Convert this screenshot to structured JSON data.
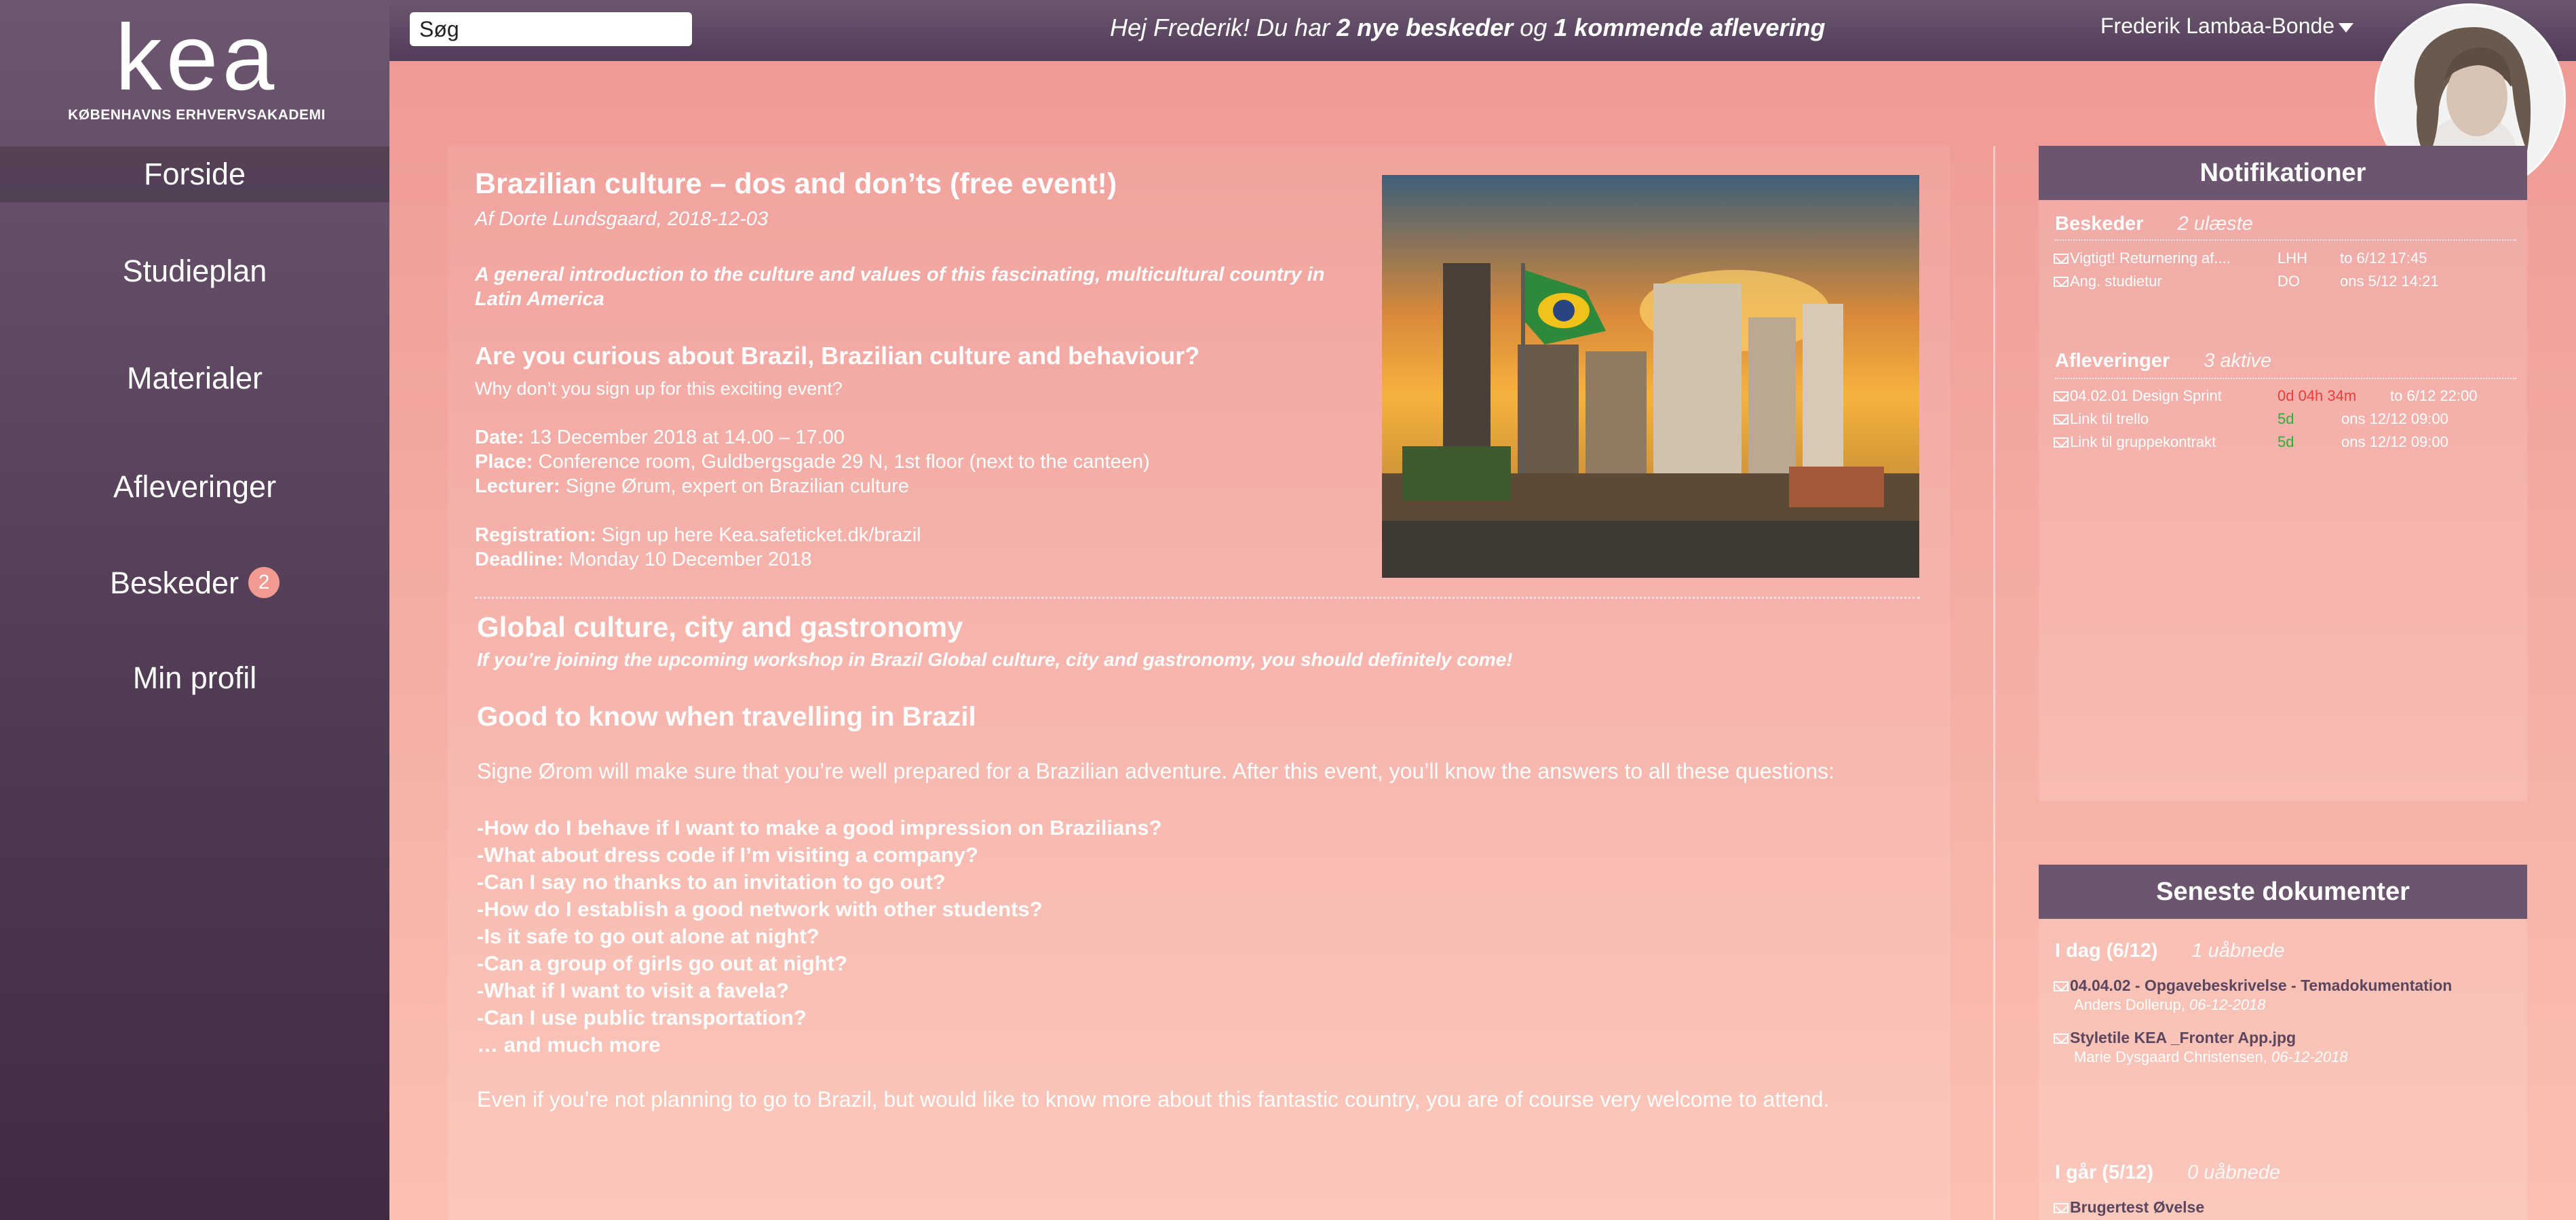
{
  "logo": {
    "word": "kea",
    "subtitle": "KØBENHAVNS ERHVERVSAKADEMI"
  },
  "nav": [
    {
      "label": "Forside"
    },
    {
      "label": "Studieplan"
    },
    {
      "label": "Materialer"
    },
    {
      "label": "Afleveringer"
    },
    {
      "label": "Beskeder",
      "badge": "2"
    },
    {
      "label": "Min profil"
    }
  ],
  "topbar": {
    "search_value": "Søg",
    "greeting_pre": "Hej Frederik! Du har ",
    "greeting_b1": "2 nye beskeder",
    "greeting_mid": " og ",
    "greeting_b2": "1 kommende aflevering",
    "user_name": "Frederik Lambaa-Bonde"
  },
  "article": {
    "title": "Brazilian culture – dos and don’ts (free event!)",
    "byline": "Af Dorte Lundsgaard, 2018-12-03",
    "intro_line1": "A general introduction to the culture and values of this fascinating, multicultural country in",
    "intro_line2": "Latin America",
    "question_title": "Are you curious about Brazil, Brazilian culture and behaviour?",
    "question_sub": "Why don’t you sign up for this exciting event?",
    "date_label": "Date:",
    "date_value": " 13 December 2018 at 14.00 – 17.00",
    "place_label": "Place:",
    "place_value": " Conference room, Guldbergsgade 29 N, 1st floor (next to the canteen)",
    "lecturer_label": "Lecturer:",
    "lecturer_value": " Signe Ørum, expert on Brazilian culture",
    "registration_label": "Registration:",
    "registration_value": " Sign up here Kea.safeticket.dk/brazil",
    "deadline_label": "Deadline:",
    "deadline_value": " Monday 10 December 2018",
    "section2_title": "Global culture, city and gastronomy",
    "section2_sub": "If you’re joining the upcoming workshop in Brazil Global culture, city and gastronomy, you should definitely come!",
    "section3_title": "Good to know when travelling in Brazil",
    "section3_text": "Signe Ørom will make sure that you’re well prepared for a Brazilian adventure. After this event, you’ll know the answers to all these questions:",
    "questions": [
      "-How do I behave if I want to make a good impression on Brazilians?",
      "-What about dress code if I’m visiting a company?",
      "-Can I say no thanks to an invitation to go out?",
      "-How do I establish a good network with other students?",
      "-Is it safe to go out alone at night?",
      "-Can a group of girls go out at night?",
      "-What if I want to visit a favela?",
      "-Can I use public transportation?",
      "… and much more"
    ],
    "closing": "Even if you’re not planning to go to Brazil, but would like to know more about this fantastic country, you are of course very welcome to attend."
  },
  "notifications": {
    "header": "Notifikationer",
    "messages_label": "Beskeder",
    "messages_count": "2 ulæste",
    "messages": [
      {
        "title": "Vigtigt! Returnering af....",
        "from": "LHH",
        "time": "to 6/12 17:45"
      },
      {
        "title": "Ang. studietur",
        "from": "DO",
        "time": "ons 5/12 14:21"
      }
    ],
    "assignments_label": "Afleveringer",
    "assignments_count": "3 aktive",
    "assignments": [
      {
        "title": "04.02.01 Design Sprint",
        "remaining": "0d 04h 34m",
        "status": "red",
        "due": "to 6/12 22:00"
      },
      {
        "title": "Link til trello",
        "remaining": "5d",
        "status": "green",
        "due": "ons 12/12  09:00"
      },
      {
        "title": "Link til gruppekontrakt",
        "remaining": "5d",
        "status": "green",
        "due": "ons 12/12  09:00"
      }
    ]
  },
  "documents": {
    "header": "Seneste dokumenter",
    "today_label": "I dag (6/12)",
    "today_count": "1 uåbnede",
    "today_docs": [
      {
        "title": "04.04.02 - Opgavebeskrivelse - Temadokumentation",
        "author": "Anders Dollerup, ",
        "date": "06-12-2018"
      },
      {
        "title": "Styletile KEA _Fronter App.jpg",
        "author": "Marie Dysgaard Christensen, ",
        "date": "06-12-2018"
      }
    ],
    "yesterday_label": "I går (5/12)",
    "yesterday_count": "0 uåbnede",
    "yesterday_docs": [
      {
        "title": "Brugertest Øvelse"
      }
    ]
  },
  "colors": {
    "sidebar": "#503a53",
    "panel_header": "#6b556f",
    "accent_red": "#e83f3a",
    "accent_green": "#2bb233",
    "badge": "#f29a92"
  }
}
